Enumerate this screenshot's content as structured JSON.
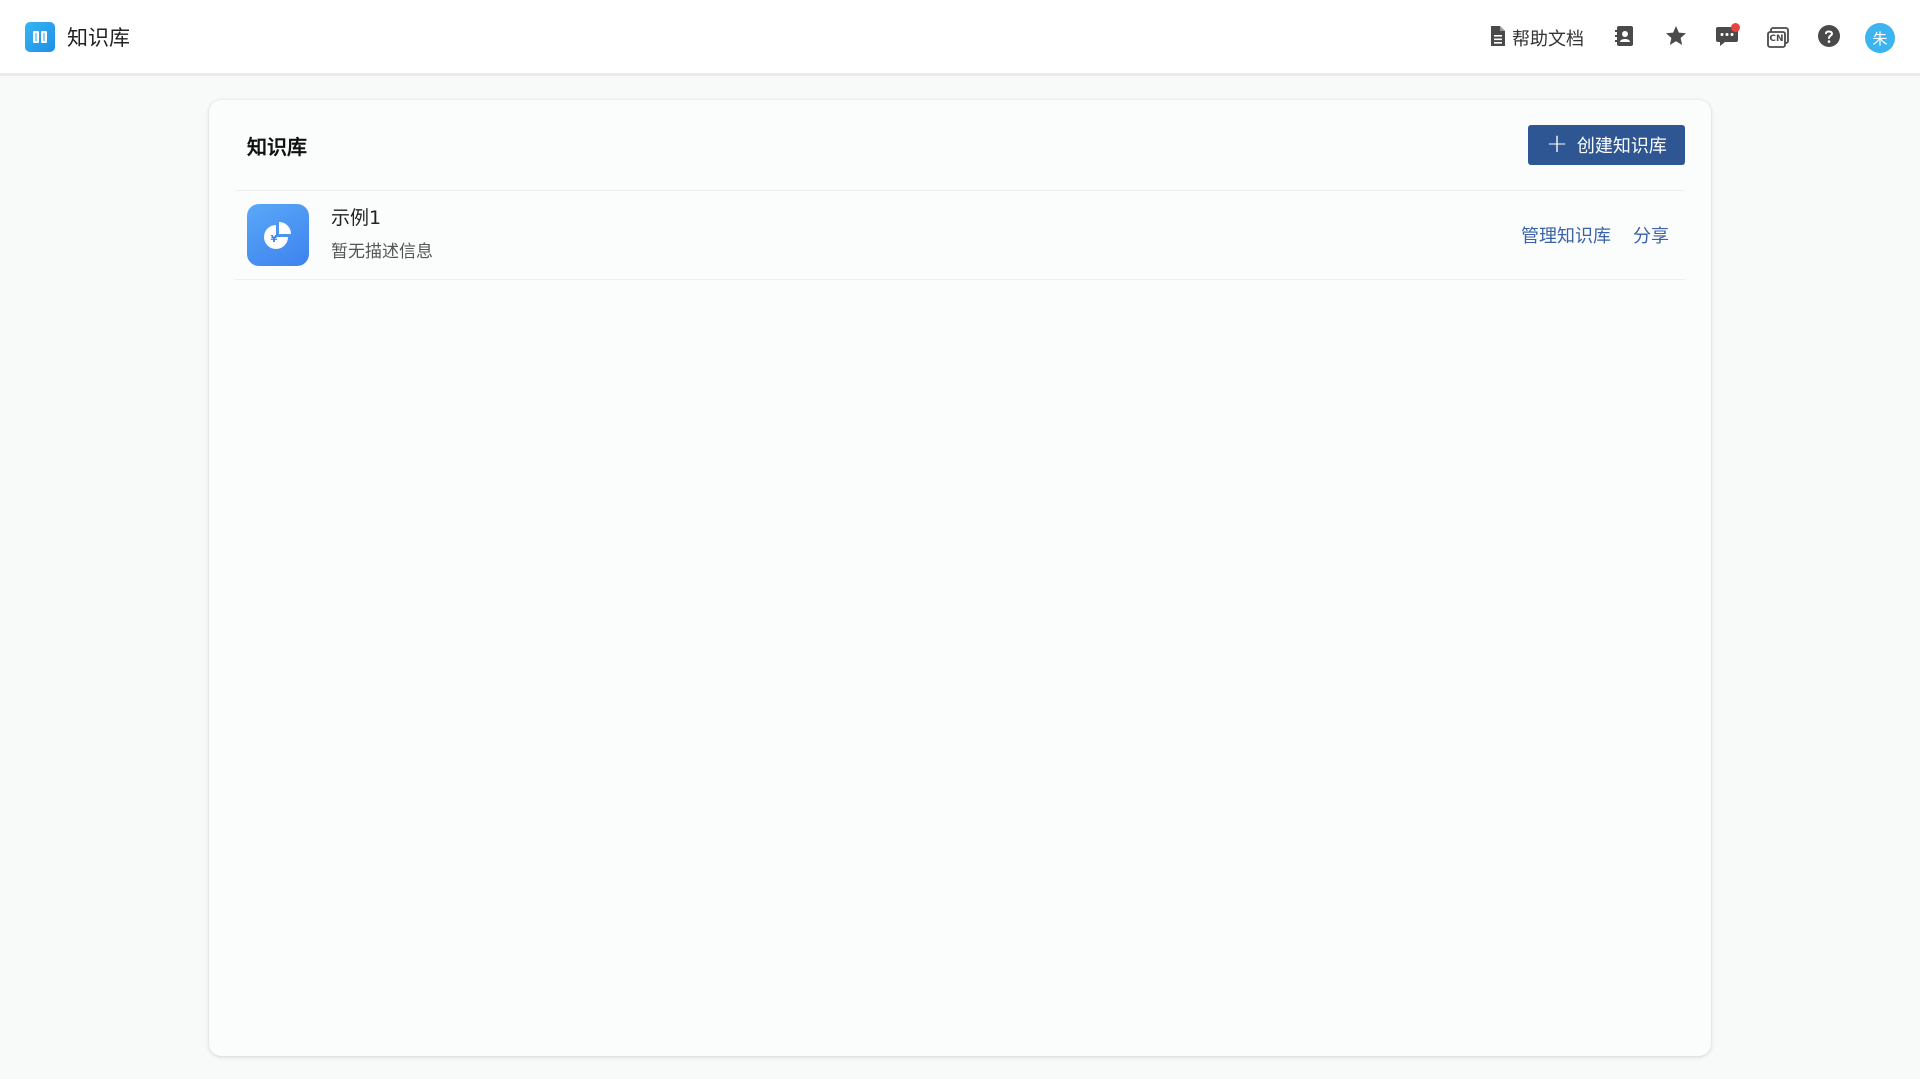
{
  "app": {
    "title": "知识库"
  },
  "header": {
    "help_docs_label": "帮助文档",
    "lang_badge": "CN",
    "avatar_text": "朱",
    "colors": {
      "notify_dot": "#e84343",
      "avatar_bg": "#3cb4ef"
    },
    "icons": [
      "document-icon",
      "contacts-icon",
      "star-icon",
      "message-icon",
      "language-icon",
      "help-icon"
    ]
  },
  "main": {
    "title": "知识库",
    "create_button_label": "创建知识库",
    "accent_color": "#2e5693",
    "knowledge_bases": [
      {
        "name": "示例1",
        "description": "暂无描述信息",
        "icon": "pie-chart-yuan-icon",
        "actions": [
          "管理知识库",
          "分享"
        ]
      }
    ]
  }
}
